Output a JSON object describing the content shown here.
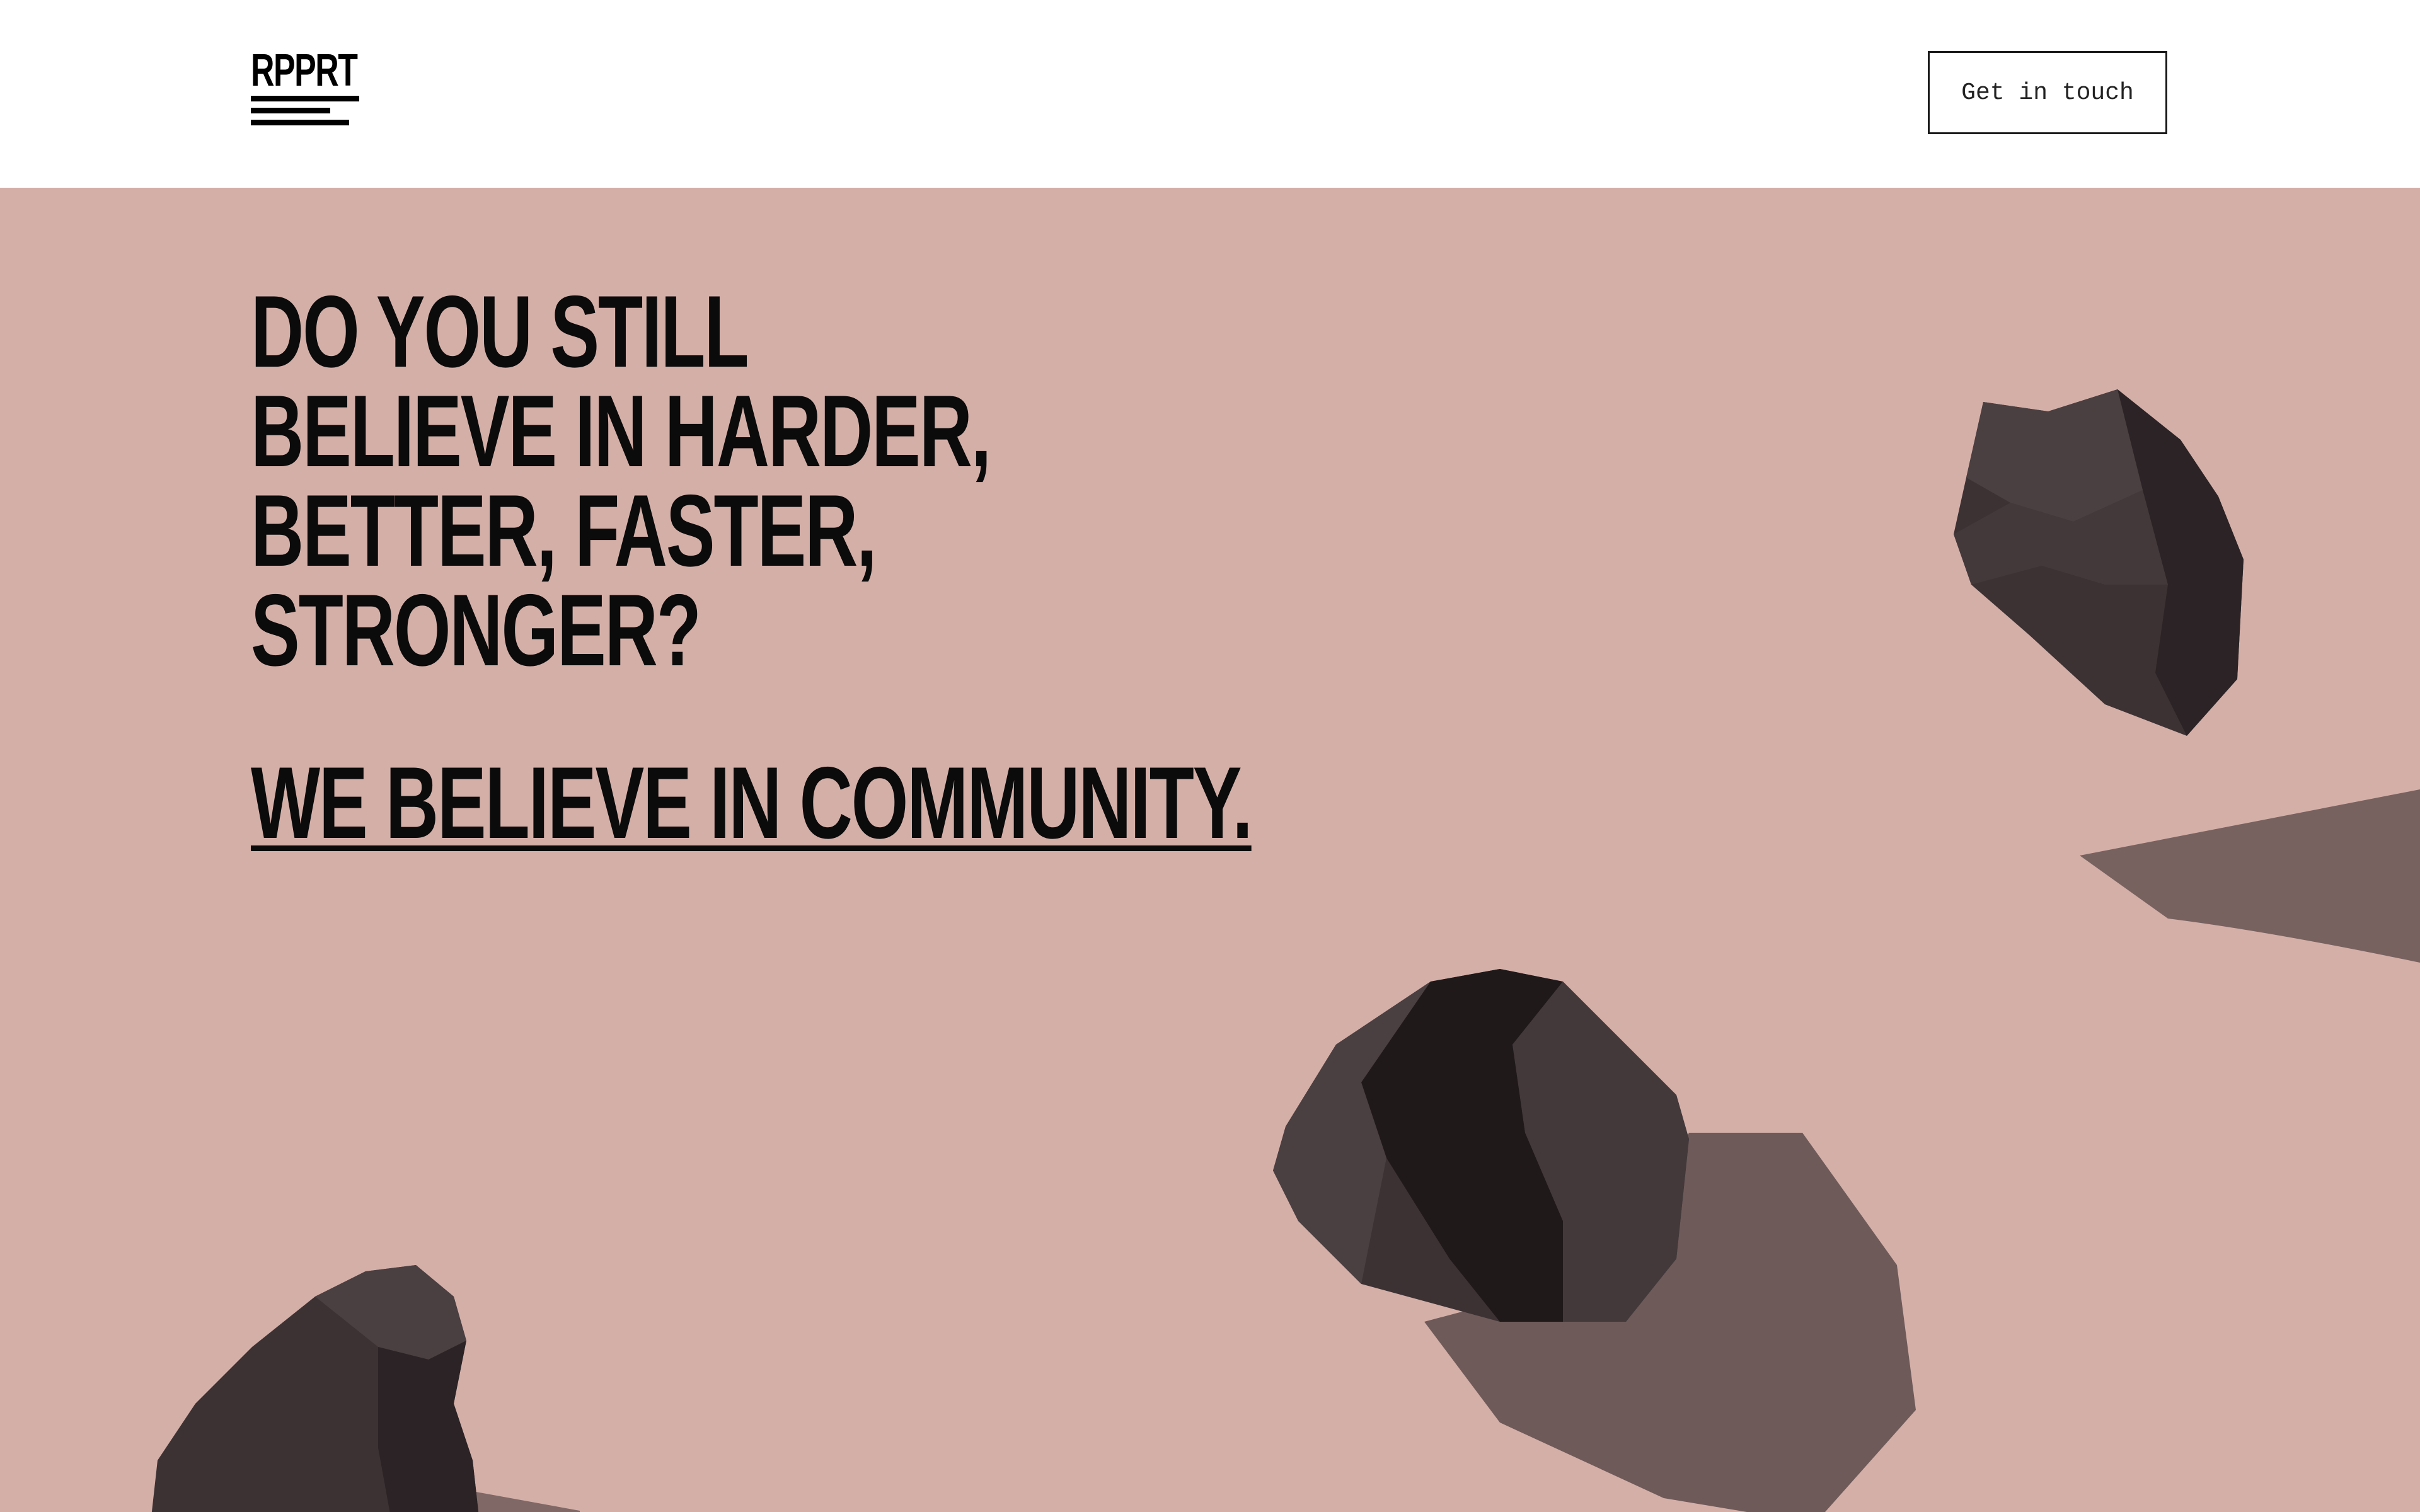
{
  "header": {
    "logo_text": "RPPRT",
    "cta_label": "Get in touch"
  },
  "hero": {
    "headline": "DO YOU STILL BELIEVE IN HARDER, BETTER, FASTER, STRONGER?",
    "tagline": "WE BELIEVE IN COMMUNITY."
  },
  "colors": {
    "background": "#d4afa8",
    "header_background": "#ffffff",
    "text": "#0b0b0b",
    "rock": "#3c3234"
  }
}
